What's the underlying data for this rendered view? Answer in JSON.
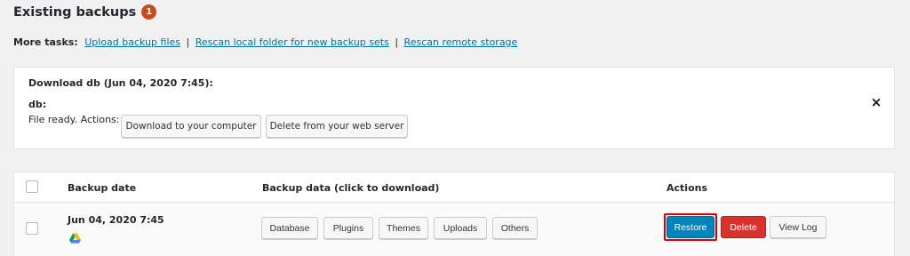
{
  "header": {
    "title": "Existing backups",
    "badge_count": "1"
  },
  "more_tasks": {
    "label": "More tasks:",
    "links": [
      "Upload backup files",
      "Rescan local folder for new backup sets",
      "Rescan remote storage"
    ],
    "separator": "|"
  },
  "download_panel": {
    "title": "Download db (Jun 04, 2020 7:45):",
    "item_name": "db:",
    "ready_text": "File ready. Actions:",
    "download_label": "Download to your computer",
    "delete_label": "Delete from your web server",
    "close_symbol": "×"
  },
  "table": {
    "headers": {
      "date": "Backup date",
      "data": "Backup data (click to download)",
      "actions": "Actions"
    },
    "rows": [
      {
        "date": "Jun 04, 2020 7:45",
        "storage_icon": "google-drive-icon",
        "data_buttons": [
          "Database",
          "Plugins",
          "Themes",
          "Uploads",
          "Others"
        ],
        "actions": {
          "restore": "Restore",
          "delete": "Delete",
          "view_log": "View Log"
        }
      }
    ]
  },
  "colors": {
    "accent_blue": "#0085ba",
    "delete_red": "#d9322c",
    "badge_orange": "#ca4a1f",
    "link_blue": "#0073aa",
    "highlight_red": "#dd0000"
  }
}
